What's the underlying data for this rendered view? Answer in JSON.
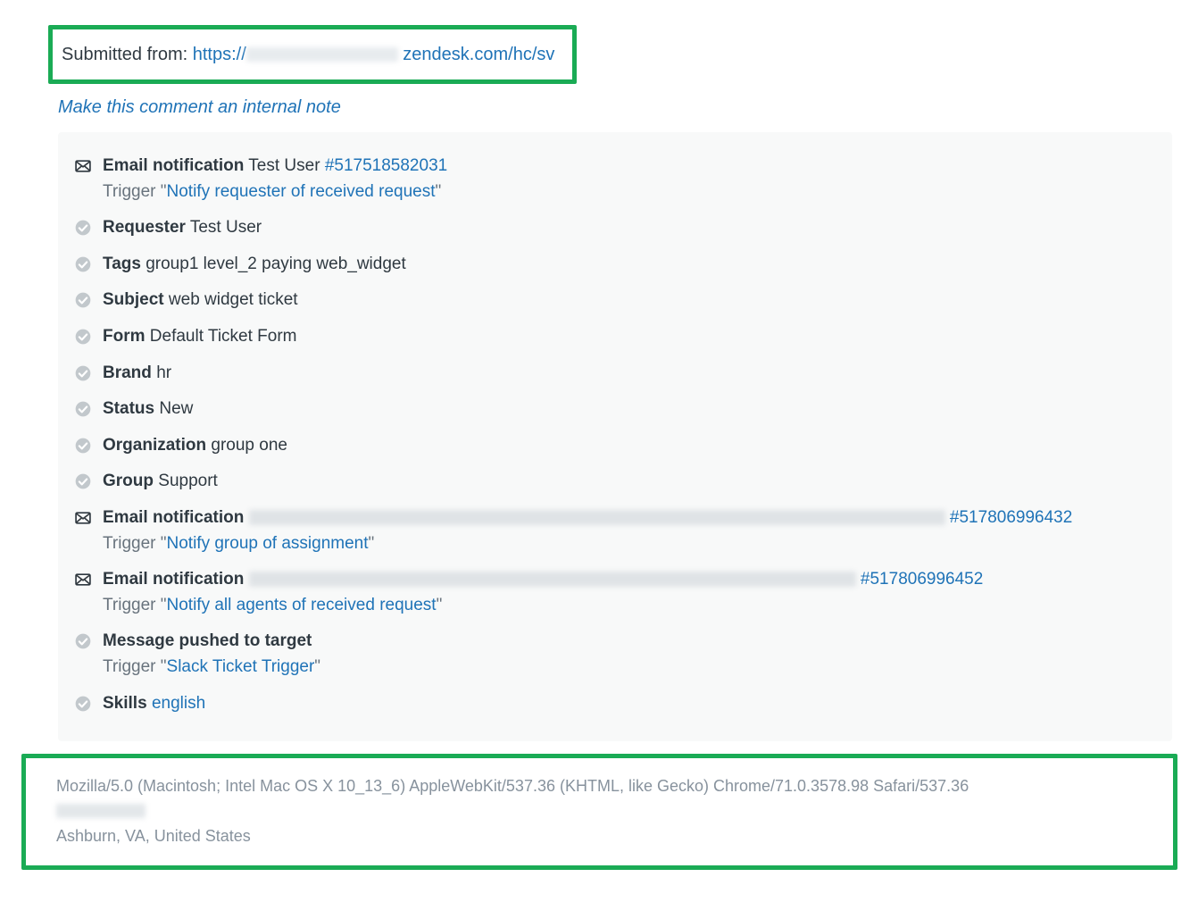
{
  "submitted": {
    "prefix": "Submitted from: ",
    "url_prefix": "https://",
    "url_suffix": " zendesk.com/hc/sv"
  },
  "internal_note_link": "Make this comment an internal note",
  "trigger_label": "Trigger",
  "events": [
    {
      "icon": "mail",
      "label": "Email notification",
      "value": "Test User",
      "id": "#517518582031",
      "trigger": "Notify requester of received request"
    },
    {
      "icon": "check",
      "label": "Requester",
      "value": "Test User"
    },
    {
      "icon": "check",
      "label": "Tags",
      "value": "group1 level_2 paying web_widget"
    },
    {
      "icon": "check",
      "label": "Subject",
      "value": "web widget ticket"
    },
    {
      "icon": "check",
      "label": "Form",
      "value": "Default Ticket Form"
    },
    {
      "icon": "check",
      "label": "Brand",
      "value": "hr"
    },
    {
      "icon": "check",
      "label": "Status",
      "value": "New"
    },
    {
      "icon": "check",
      "label": "Organization",
      "value": "group one"
    },
    {
      "icon": "check",
      "label": "Group",
      "value": "Support"
    },
    {
      "icon": "mail",
      "label": "Email notification",
      "redacted": true,
      "redact_class": "redact-780",
      "id": "#517806996432",
      "trigger": "Notify group of assignment"
    },
    {
      "icon": "mail",
      "label": "Email notification",
      "redacted": true,
      "redact_class": "redact-680",
      "id": "#517806996452",
      "trigger": "Notify all agents of received request"
    },
    {
      "icon": "check",
      "label": "Message pushed to target",
      "value": "",
      "trigger": "Slack Ticket Trigger"
    },
    {
      "icon": "check",
      "label": "Skills",
      "value_link": "english"
    }
  ],
  "footer": {
    "user_agent": "Mozilla/5.0 (Macintosh; Intel Mac OS X 10_13_6) AppleWebKit/537.36 (KHTML, like Gecko) Chrome/71.0.3578.98 Safari/537.36",
    "location": "Ashburn, VA, United States"
  }
}
